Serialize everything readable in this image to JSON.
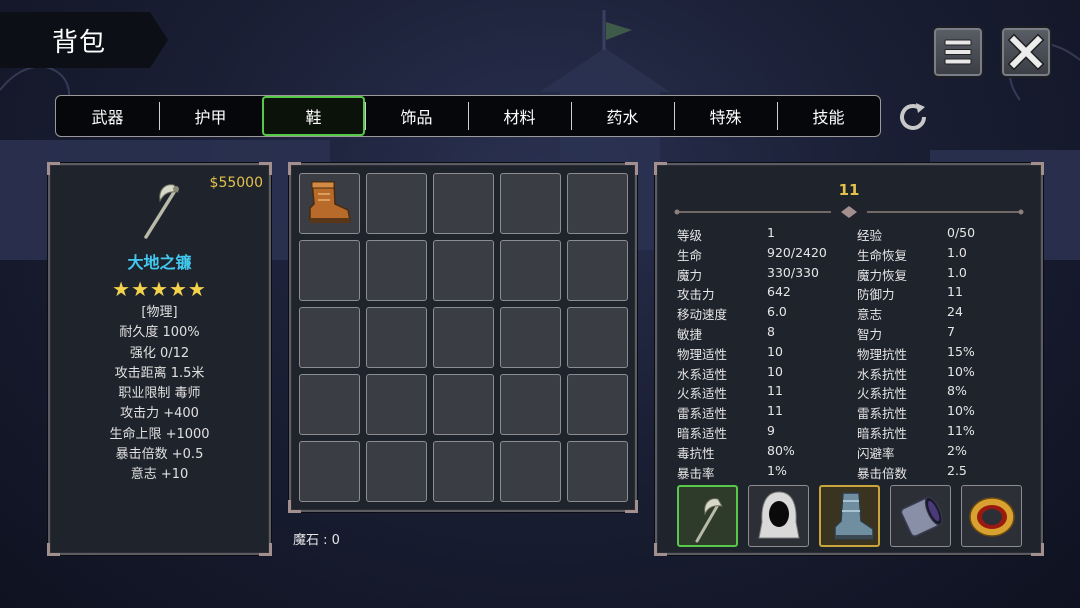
{
  "header": {
    "title": "背包"
  },
  "tabs": [
    {
      "label": "武器",
      "active": false
    },
    {
      "label": "护甲",
      "active": false
    },
    {
      "label": "鞋",
      "active": true
    },
    {
      "label": "饰品",
      "active": false
    },
    {
      "label": "材料",
      "active": false
    },
    {
      "label": "药水",
      "active": false
    },
    {
      "label": "特殊",
      "active": false
    },
    {
      "label": "技能",
      "active": false
    }
  ],
  "item_detail": {
    "price": "$55000",
    "name": "大地之镰",
    "stars": "★★★★★",
    "star_count": 5,
    "lines": [
      "[物理]",
      "耐久度 100%",
      "强化 0/12",
      "攻击距离  1.5米",
      "职业限制  毒师",
      "攻击力  +400",
      "生命上限  +1000",
      "暴击倍数  +0.5",
      "意志  +10"
    ]
  },
  "inventory": {
    "slots": 25,
    "items": [
      {
        "slot": 0,
        "icon": "boots-icon"
      }
    ],
    "magic_stone_label": "魔石 : 0"
  },
  "character": {
    "level": "11",
    "stats": [
      [
        "等级",
        "1",
        "经验",
        "0/50"
      ],
      [
        "生命",
        "920/2420",
        "生命恢复",
        "1.0"
      ],
      [
        "魔力",
        "330/330",
        "魔力恢复",
        "1.0"
      ],
      [
        "攻击力",
        "642",
        "防御力",
        "11"
      ],
      [
        "移动速度",
        "6.0",
        "意志",
        "24"
      ],
      [
        "敏捷",
        "8",
        "智力",
        "7"
      ],
      [
        "物理适性",
        "10",
        "物理抗性",
        "15%"
      ],
      [
        "水系适性",
        "10",
        "水系抗性",
        "10%"
      ],
      [
        "火系适性",
        "11",
        "火系抗性",
        "8%"
      ],
      [
        "雷系适性",
        "11",
        "雷系抗性",
        "10%"
      ],
      [
        "暗系适性",
        "9",
        "暗系抗性",
        "11%"
      ],
      [
        "毒抗性",
        "80%",
        "闪避率",
        "2%"
      ],
      [
        "暴击率",
        "1%",
        "暴击倍数",
        "2.5"
      ]
    ],
    "equipment": [
      {
        "icon": "scythe-icon",
        "state": "selected"
      },
      {
        "icon": "hood-icon",
        "state": "normal"
      },
      {
        "icon": "armored-boots-icon",
        "state": "gold"
      },
      {
        "icon": "bracer-icon",
        "state": "normal"
      },
      {
        "icon": "ring-icon",
        "state": "normal"
      }
    ]
  },
  "colors": {
    "active_tab": "#57c84a",
    "price": "#e4c14a",
    "item_name": "#42c9f0",
    "stars": "#f3d24c"
  }
}
